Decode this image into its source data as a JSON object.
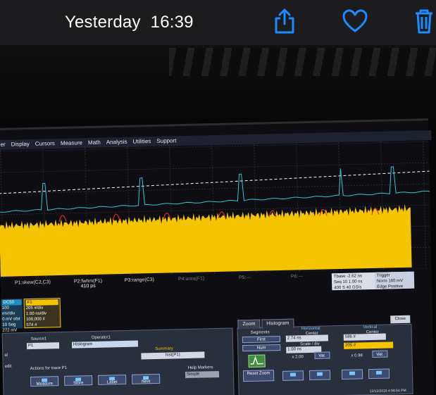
{
  "viewer": {
    "title": "Yesterday",
    "time": "16:39",
    "icons": [
      "share-icon",
      "heart-icon",
      "trash-icon"
    ],
    "accent": "#1a8cff"
  },
  "scope": {
    "menu": [
      "er",
      "Display",
      "Cursors",
      "Measure",
      "Math",
      "Analysis",
      "Utilities",
      "Support"
    ],
    "colors": {
      "trace_blue": "#35c6d8",
      "trace_yellow": "#f5c400",
      "trace_red": "#e03030",
      "marker_white": "#ffffff"
    },
    "params": [
      {
        "label": "P1:skew(C2,C3)",
        "value": ""
      },
      {
        "label": "P2:fwhm(F1)",
        "value": "410 ps"
      },
      {
        "label": "P3:range(C3)",
        "value": ""
      },
      {
        "label": "P4:area(F1)",
        "value": ""
      },
      {
        "label": "P5:---",
        "value": ""
      },
      {
        "label": "P6:---",
        "value": ""
      },
      {
        "label": "P7:---",
        "value": ""
      },
      {
        "label": "P8:",
        "value": ""
      }
    ],
    "timebase": {
      "tbase": "Tbase",
      "tbase_val": "-2.62 ns",
      "seq": "Seq 10",
      "seq_val": "1.00 ns",
      "samples": "400 S",
      "rate": "40 GS/s"
    },
    "trigger": {
      "label": "Trigger",
      "mode": "Norm",
      "level": "160 mV",
      "type": "Edge",
      "slope": "Positive"
    },
    "chan_blue": {
      "name": "DC50",
      "vdiv": "100 mV/div",
      "offset": "0 mV ofst",
      "extra": "10 Seg",
      "readout": "272 mV"
    },
    "chan_yellow": {
      "name": "F1",
      "vdiv": "205 #/div",
      "tdiv": "1.00 ns/div",
      "pts": "100,000 #",
      "readout": "574 #"
    },
    "source_label": "Source1",
    "source_value": "P1",
    "operator_label": "Operator1",
    "operator_value": "Histogram",
    "summary_label": "Summary",
    "summary_value": "hist(P1)",
    "actions_label": "Actions for trace P1",
    "buttons": [
      "Measure",
      "Store",
      "Label",
      "Next"
    ],
    "help_label": "Help Markers",
    "help_value": "Simple",
    "zoom_tab": "Zoom",
    "histogram_tab": "Histogram",
    "segments_label": "Segments",
    "first_label": "First",
    "num_label": "Num",
    "horizontal_label": "Horizontal",
    "center_label": "Center",
    "horiz_center": "2.74 ns",
    "scale_label": "Scale / div",
    "horiz_scale": "1.00 ns",
    "vertical_label": "Vertical",
    "vert_center": "586 #",
    "vert_scale": "205 #",
    "x_scale": "x 2.00",
    "x_scale2": "x 0.98",
    "var_label": "Var.",
    "reset_zoom": "Reset Zoom",
    "close_label": "Close",
    "date_stamp": "12/12/2018 4:58:54 PM",
    "left_label": "al",
    "edit_label": "edit"
  }
}
